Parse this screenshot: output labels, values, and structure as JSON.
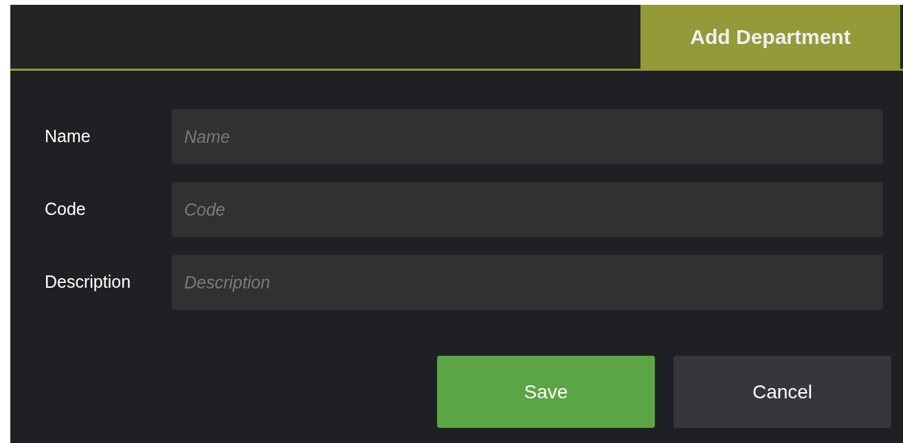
{
  "tab": {
    "label": "Add Department"
  },
  "fields": [
    {
      "label": "Name",
      "placeholder": "Name"
    },
    {
      "label": "Code",
      "placeholder": "Code"
    },
    {
      "label": "Description",
      "placeholder": "Description"
    }
  ],
  "buttons": [
    {
      "label": "Save",
      "kind": "primary"
    },
    {
      "label": "Cancel",
      "kind": "secondary"
    }
  ]
}
